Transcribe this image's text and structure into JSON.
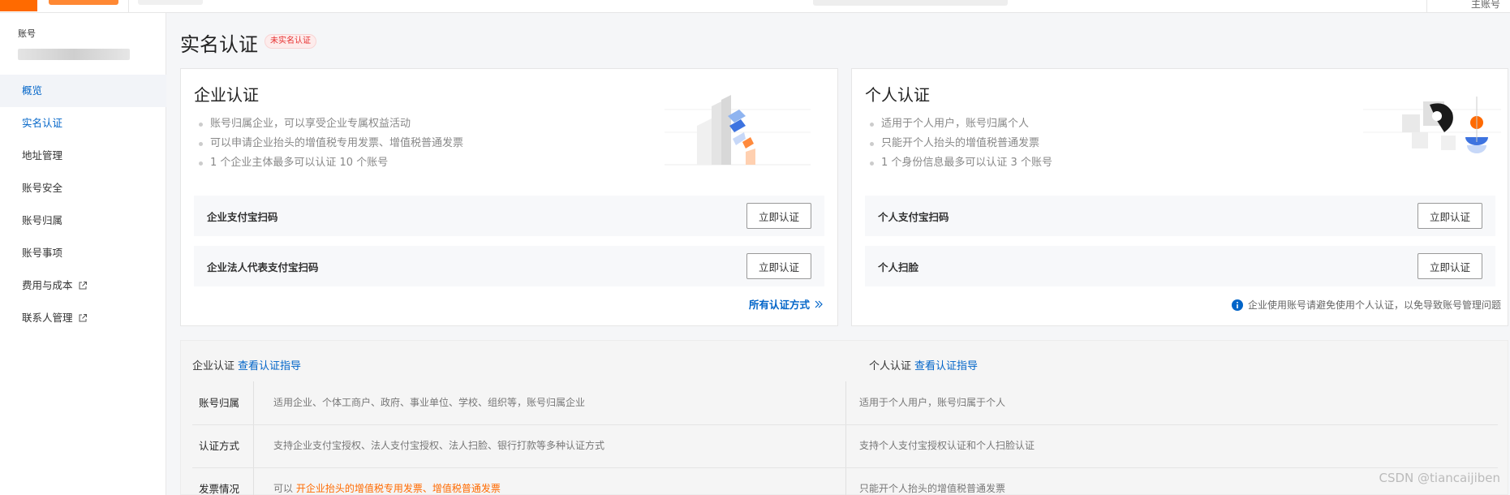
{
  "topbar": {
    "account_text": "主账号"
  },
  "sidebar": {
    "account_label": "账号",
    "items": [
      {
        "label": "概览"
      },
      {
        "label": "实名认证"
      },
      {
        "label": "地址管理"
      },
      {
        "label": "账号安全"
      },
      {
        "label": "账号归属"
      },
      {
        "label": "账号事项"
      },
      {
        "label": "费用与成本"
      },
      {
        "label": "联系人管理"
      }
    ]
  },
  "page": {
    "title": "实名认证",
    "status_badge": "未实名认证"
  },
  "enterprise_card": {
    "title": "企业认证",
    "bullets": [
      "账号归属企业，可以享受企业专属权益活动",
      "可以申请企业抬头的增值税专用发票、增值税普通发票",
      "1 个企业主体最多可以认证 10 个账号"
    ],
    "methods": [
      {
        "label": "企业支付宝扫码",
        "button": "立即认证"
      },
      {
        "label": "企业法人代表支付宝扫码",
        "button": "立即认证"
      }
    ],
    "all_methods_link": "所有认证方式"
  },
  "personal_card": {
    "title": "个人认证",
    "bullets": [
      "适用于个人用户，账号归属个人",
      "只能开个人抬头的增值税普通发票",
      "1 个身份信息最多可以认证 3 个账号"
    ],
    "methods": [
      {
        "label": "个人支付宝扫码",
        "button": "立即认证"
      },
      {
        "label": "个人扫脸",
        "button": "立即认证"
      }
    ],
    "tip": "企业使用账号请避免使用个人认证，以免导致账号管理问题"
  },
  "compare": {
    "enterprise_head": "企业认证",
    "personal_head": "个人认证",
    "guide_link": "查看认证指导",
    "rows": [
      {
        "label": "账号归属",
        "enterprise": "适用企业、个体工商户、政府、事业单位、学校、组织等，账号归属企业",
        "personal": "适用于个人用户，账号归属于个人"
      },
      {
        "label": "认证方式",
        "enterprise": "支持企业支付宝授权、法人支付宝授权、法人扫脸、银行打款等多种认证方式",
        "personal": "支持个人支付宝授权认证和个人扫脸认证"
      },
      {
        "label": "发票情况",
        "enterprise_prefix": "可以",
        "enterprise_highlight": "开企业抬头的增值税专用发票、增值税普通发票",
        "personal": "只能开个人抬头的增值税普通发票"
      }
    ]
  },
  "watermark": "CSDN @tiancaijiben",
  "colors": {
    "accent": "#0064c8",
    "brand": "#ff6a00",
    "badge": "#e62e2e"
  }
}
